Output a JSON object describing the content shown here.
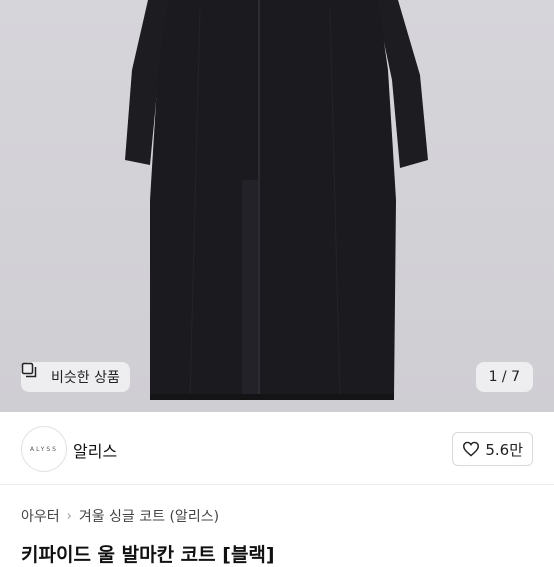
{
  "gallery": {
    "similar_label": "비슷한 상품",
    "counter": "1 / 7"
  },
  "seller": {
    "logo_text": "ALYSS",
    "name": "알리스",
    "likes": "5.6만"
  },
  "breadcrumb": {
    "category": "아우터",
    "sub": "겨울 싱글 코트 (알리스)"
  },
  "product": {
    "title": "키파이드 울 발마칸 코트 [블랙]"
  },
  "colors": {
    "coat": "#1b1b1f",
    "background": "#d3d2d7"
  }
}
